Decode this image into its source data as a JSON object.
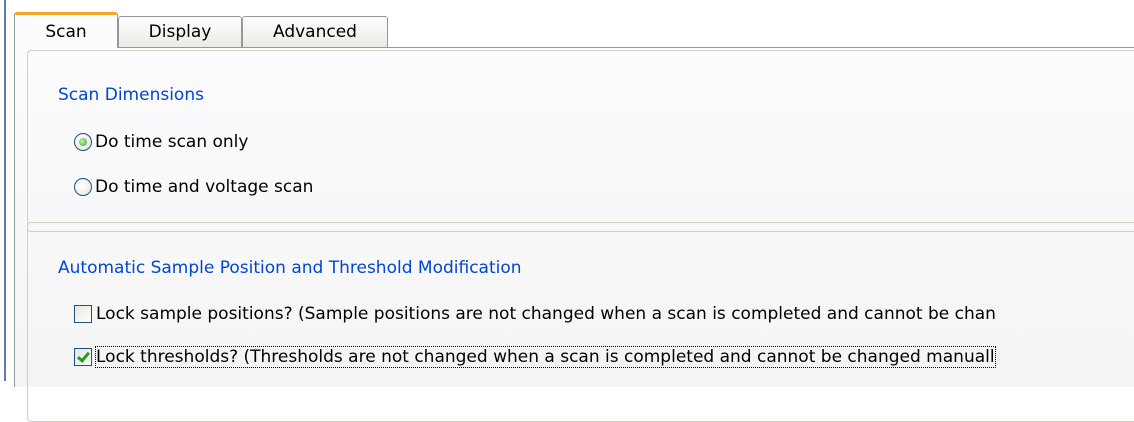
{
  "tabs": [
    {
      "label": "Scan",
      "active": true
    },
    {
      "label": "Display",
      "active": false
    },
    {
      "label": "Advanced",
      "active": false
    }
  ],
  "scan_dimensions": {
    "legend": "Scan Dimensions",
    "options": [
      {
        "label": "Do time scan only",
        "selected": true
      },
      {
        "label": "Do time and voltage scan",
        "selected": false
      }
    ]
  },
  "automatic": {
    "legend": "Automatic Sample Position and Threshold Modification",
    "checkboxes": [
      {
        "label": "Lock sample positions? (Sample positions are not changed when a scan is completed and cannot be chan",
        "checked": false
      },
      {
        "label": "Lock thresholds? (Thresholds are not changed when a scan is completed and cannot be changed manuall",
        "checked": true
      }
    ]
  },
  "colors": {
    "legend_text": "#0046d5",
    "active_tab_accent": "#f5a623",
    "check_green": "#21a121"
  }
}
